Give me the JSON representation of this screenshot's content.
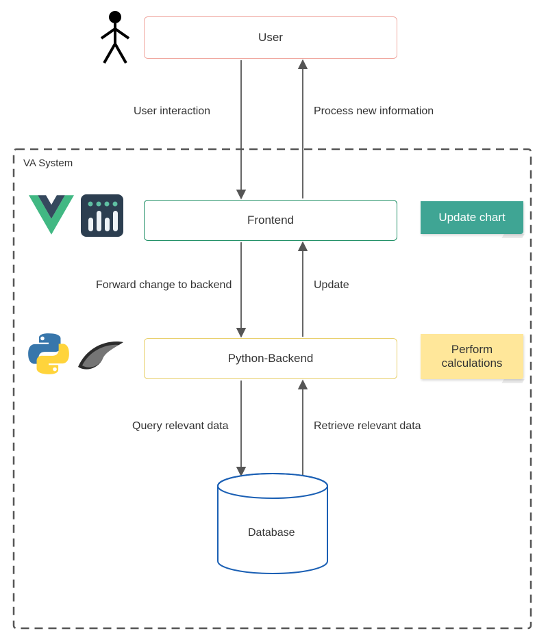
{
  "nodes": {
    "user": "User",
    "frontend": "Frontend",
    "backend": "Python-Backend",
    "database": "Database"
  },
  "container_label": "VA System",
  "edges": {
    "user_interaction": "User interaction",
    "process_new_info": "Process new information",
    "forward_change": "Forward change to backend",
    "update": "Update",
    "query_data": "Query relevant data",
    "retrieve_data": "Retrieve relevant data"
  },
  "stickies": {
    "update_chart": "Update chart",
    "perform_calc": "Perform\ncalculations"
  },
  "icons": {
    "user": "person-icon",
    "vue": "vue-logo-icon",
    "plotly": "plotly-logo-icon",
    "python": "python-logo-icon",
    "flask": "flask-logo-icon"
  }
}
